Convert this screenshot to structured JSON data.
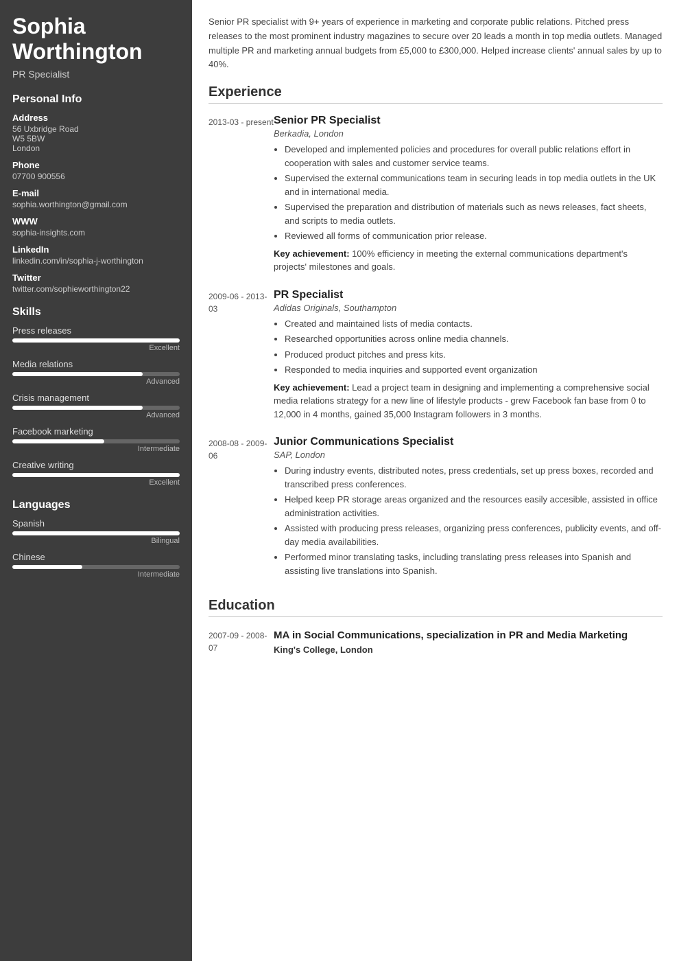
{
  "sidebar": {
    "name": "Sophia Worthington",
    "title": "PR Specialist",
    "personal_info": {
      "section_label": "Personal Info",
      "address_label": "Address",
      "address_lines": [
        "56 Uxbridge Road",
        "W5 5BW",
        "London"
      ],
      "phone_label": "Phone",
      "phone": "07700 900556",
      "email_label": "E-mail",
      "email": "sophia.worthington@gmail.com",
      "www_label": "WWW",
      "www": "sophia-insights.com",
      "linkedin_label": "LinkedIn",
      "linkedin": "linkedin.com/in/sophia-j-worthington",
      "twitter_label": "Twitter",
      "twitter": "twitter.com/sophieworthington22"
    },
    "skills": {
      "section_label": "Skills",
      "items": [
        {
          "name": "Press releases",
          "level": "Excellent",
          "pct": 100
        },
        {
          "name": "Media relations",
          "level": "Advanced",
          "pct": 78
        },
        {
          "name": "Crisis management",
          "level": "Advanced",
          "pct": 78
        },
        {
          "name": "Facebook marketing",
          "level": "Intermediate",
          "pct": 55
        },
        {
          "name": "Creative writing",
          "level": "Excellent",
          "pct": 100
        }
      ]
    },
    "languages": {
      "section_label": "Languages",
      "items": [
        {
          "name": "Spanish",
          "level": "Bilingual",
          "pct": 100
        },
        {
          "name": "Chinese",
          "level": "Intermediate",
          "pct": 42
        }
      ]
    }
  },
  "main": {
    "summary": "Senior PR specialist with 9+ years of experience in marketing and corporate public relations. Pitched press releases to the most prominent industry magazines to secure over 20 leads a month in top media outlets. Managed multiple PR and marketing annual budgets from £5,000 to £300,000. Helped increase clients' annual sales by up to 40%.",
    "experience": {
      "section_label": "Experience",
      "entries": [
        {
          "date": "2013-03 - present",
          "role": "Senior PR Specialist",
          "company": "Berkadia, London",
          "bullets": [
            "Developed and implemented policies and procedures for overall public relations effort in cooperation with sales and customer service teams.",
            "Supervised the external communications team in securing leads in top media outlets in the UK and in international media.",
            "Supervised the preparation and distribution of materials such as news releases, fact sheets, and scripts to media outlets.",
            "Reviewed all forms of communication prior release."
          ],
          "achievement": "Key achievement: 100% efficiency in meeting the external communications department's projects' milestones and goals."
        },
        {
          "date": "2009-06 - 2013-03",
          "role": "PR Specialist",
          "company": "Adidas Originals, Southampton",
          "bullets": [
            "Created and maintained lists of media contacts.",
            "Researched opportunities across online media channels.",
            "Produced product pitches and press kits.",
            "Responded to media inquiries and supported event organization"
          ],
          "achievement": "Key achievement: Lead a project team in designing and implementing a comprehensive social media relations strategy for a new line of lifestyle products - grew Facebook fan base from 0 to 12,000 in 4 months, gained 35,000 Instagram followers in 3 months."
        },
        {
          "date": "2008-08 - 2009-06",
          "role": "Junior Communications Specialist",
          "company": "SAP, London",
          "bullets": [
            "During industry events, distributed notes, press credentials, set up press boxes, recorded and transcribed press conferences.",
            "Helped keep PR storage areas organized and the resources easily accesible, assisted in office administration activities.",
            "Assisted with producing press releases, organizing press conferences, publicity events, and off-day media availabilities.",
            "Performed minor translating tasks, including translating press releases into Spanish and assisting live translations into Spanish."
          ],
          "achievement": ""
        }
      ]
    },
    "education": {
      "section_label": "Education",
      "entries": [
        {
          "date": "2007-09 - 2008-07",
          "degree": "MA in Social Communications, specialization in PR and Media Marketing",
          "school": "King's College, London"
        }
      ]
    }
  }
}
